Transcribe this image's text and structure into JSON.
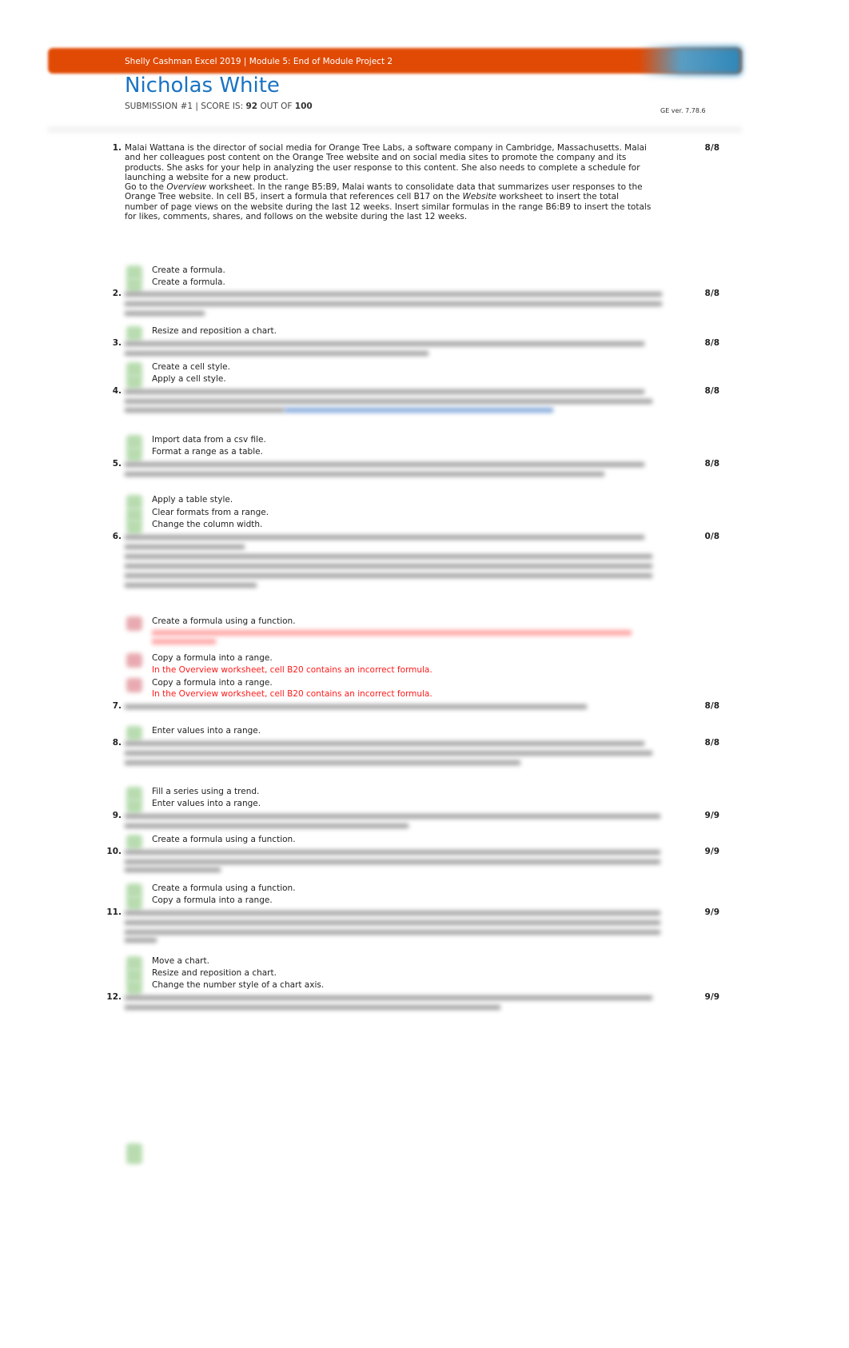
{
  "header": {
    "course": "Shelly Cashman Excel 2019 | Module 5: End of Module Project 2",
    "student_name": "Nicholas White",
    "submission_prefix": "SUBMISSION #1 | SCORE IS:",
    "score": "92",
    "out_of_label": "OUT OF",
    "total": "100",
    "version": "GE ver. 7.78.6",
    "banner_color": "#e04a05",
    "name_color": "#1a73c2"
  },
  "steps": [
    {
      "number": "1.",
      "points": "8/8",
      "description_p1_a": "Malai Wattana is the director of social media for Orange Tree Labs, a software company in Cambridge, Massachusetts. Malai and her colleagues post content on the Orange Tree website and on social media sites to promote the company and its products. She asks for your help in analyzing the user response to this content. She also needs to complete a schedule for launching a website for a new product.",
      "description_p2_a": "Go to the ",
      "description_p2_b": "Overview",
      "description_p2_c": " worksheet. In the range B5:B9, Malai wants to consolidate data that summarizes user responses to the Orange Tree website. In cell B5, insert a formula that references cell B17 on the ",
      "description_p2_d": "Website",
      "description_p2_e": " worksheet to insert the total number of page views on the website during the last 12 weeks. Insert similar formulas in the range B6:B9 to insert the totals for likes, comments, shares, and follows on the website during the last 12 weeks.",
      "checks": [
        "Create a formula.",
        "Create a formula."
      ]
    },
    {
      "number": "2.",
      "points": "8/8",
      "checks": [
        "Resize and reposition a chart."
      ]
    },
    {
      "number": "3.",
      "points": "8/8",
      "checks": [
        "Create a cell style.",
        "Apply a cell style."
      ]
    },
    {
      "number": "4.",
      "points": "8/8",
      "checks": [
        "Import data from a csv file.",
        "Format a range as a table."
      ]
    },
    {
      "number": "5.",
      "points": "8/8",
      "checks": [
        "Apply a table style.",
        "Clear formats from a range.",
        "Change the column width."
      ]
    },
    {
      "number": "6.",
      "points": "0/8",
      "checks": [
        "Create a formula using a function.",
        "Copy a formula into a range.",
        "Copy a formula into a range."
      ],
      "errors": [
        "In the Overview worksheet, cell B20 contains an incorrect formula.",
        "In the Overview worksheet, cell B20 contains an incorrect formula."
      ]
    },
    {
      "number": "7.",
      "points": "8/8",
      "checks": [
        "Enter values into a range."
      ]
    },
    {
      "number": "8.",
      "points": "8/8",
      "checks": [
        "Fill a series using a trend.",
        "Enter values into a range."
      ]
    },
    {
      "number": "9.",
      "points": "9/9",
      "checks": [
        "Create a formula using a function."
      ]
    },
    {
      "number": "10.",
      "points": "9/9",
      "checks": [
        "Create a formula using a function.",
        "Copy a formula into a range."
      ]
    },
    {
      "number": "11.",
      "points": "9/9",
      "checks": [
        "Move a chart.",
        "Resize and reposition a chart.",
        "Change the number style of a chart axis."
      ]
    },
    {
      "number": "12.",
      "points": "9/9"
    }
  ],
  "icons": {
    "pass": "check-pass-icon",
    "fail": "check-fail-icon",
    "pass_color": "#b8dcb0",
    "fail_color": "#e8aab0",
    "error_color": "#ff1a1a"
  }
}
